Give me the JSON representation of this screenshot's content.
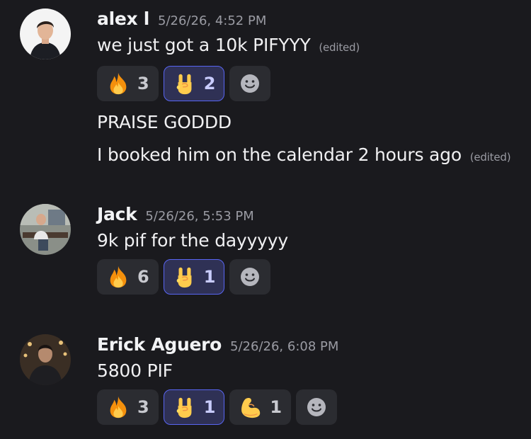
{
  "messages": [
    {
      "author": "alex l",
      "timestamp": "5/26/26, 4:52 PM",
      "lines": [
        {
          "text": "we just got a 10k PIFYYY",
          "edited": "(edited)"
        },
        {
          "text": "PRAISE GODDD",
          "edited": ""
        },
        {
          "text": "I booked him on the calendar 2 hours ago",
          "edited": "(edited)"
        }
      ],
      "reactions": [
        {
          "emoji": "fire-icon",
          "count": "3",
          "active": false
        },
        {
          "emoji": "rock-on-hand-icon",
          "count": "2",
          "active": true
        }
      ]
    },
    {
      "author": "Jack",
      "timestamp": "5/26/26, 5:53 PM",
      "lines": [
        {
          "text": "9k pif for the dayyyyy",
          "edited": ""
        }
      ],
      "reactions": [
        {
          "emoji": "fire-icon",
          "count": "6",
          "active": false
        },
        {
          "emoji": "rock-on-hand-icon",
          "count": "1",
          "active": true
        }
      ]
    },
    {
      "author": "Erick Aguero",
      "timestamp": "5/26/26, 6:08 PM",
      "lines": [
        {
          "text": "5800 PIF",
          "edited": ""
        }
      ],
      "reactions": [
        {
          "emoji": "fire-icon",
          "count": "3",
          "active": false
        },
        {
          "emoji": "rock-on-hand-icon",
          "count": "1",
          "active": true
        },
        {
          "emoji": "flexed-biceps-icon",
          "count": "1",
          "active": false
        }
      ]
    }
  ],
  "colors": {
    "background": "#1a1a1e",
    "reaction_bg": "#2b2c31",
    "reaction_active_bg": "#2f3155",
    "reaction_active_border": "#5865f2"
  }
}
